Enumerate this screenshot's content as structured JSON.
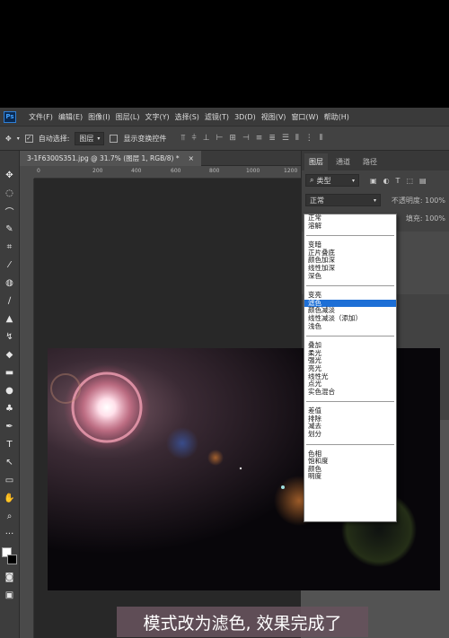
{
  "menubar": {
    "logo": "Ps",
    "items": [
      "文件(F)",
      "编辑(E)",
      "图像(I)",
      "图层(L)",
      "文字(Y)",
      "选择(S)",
      "滤镜(T)",
      "3D(D)",
      "视图(V)",
      "窗口(W)",
      "帮助(H)"
    ]
  },
  "options_bar": {
    "auto_select_label": "自动选择:",
    "auto_select_checked": true,
    "auto_select_value": "图层",
    "show_transform_label": "显示变换控件"
  },
  "document_tab": {
    "title": "3-1F6300S351.jpg @ 31.7% (图层 1, RGB/8) *",
    "close": "×"
  },
  "ruler_ticks": [
    "0",
    "200",
    "400",
    "600",
    "800",
    "1000",
    "1200"
  ],
  "layers_panel": {
    "tabs": [
      "图层",
      "通道",
      "路径"
    ],
    "active_tab": 0,
    "kind_label": "类型",
    "blend_mode": "正常",
    "opacity_label": "不透明度:",
    "opacity_value": "100%",
    "fill_label": "填充:",
    "fill_value": "100%"
  },
  "blend_dropdown": {
    "groups": [
      [
        "正常",
        "溶解"
      ],
      [
        "变暗",
        "正片叠底",
        "颜色加深",
        "线性加深",
        "深色"
      ],
      [
        "变亮",
        "滤色",
        "颜色减淡",
        "线性减淡（添加）",
        "浅色"
      ],
      [
        "叠加",
        "柔光",
        "强光",
        "亮光",
        "线性光",
        "点光",
        "实色混合"
      ],
      [
        "差值",
        "排除",
        "减去",
        "划分"
      ],
      [
        "色相",
        "饱和度",
        "颜色",
        "明度"
      ]
    ],
    "selected": "滤色"
  },
  "subtitle": "模式改为滤色, 效果完成了",
  "colors": {
    "foreground": "#ffffff",
    "background": "#000000",
    "highlight": "#1d6fd6"
  }
}
